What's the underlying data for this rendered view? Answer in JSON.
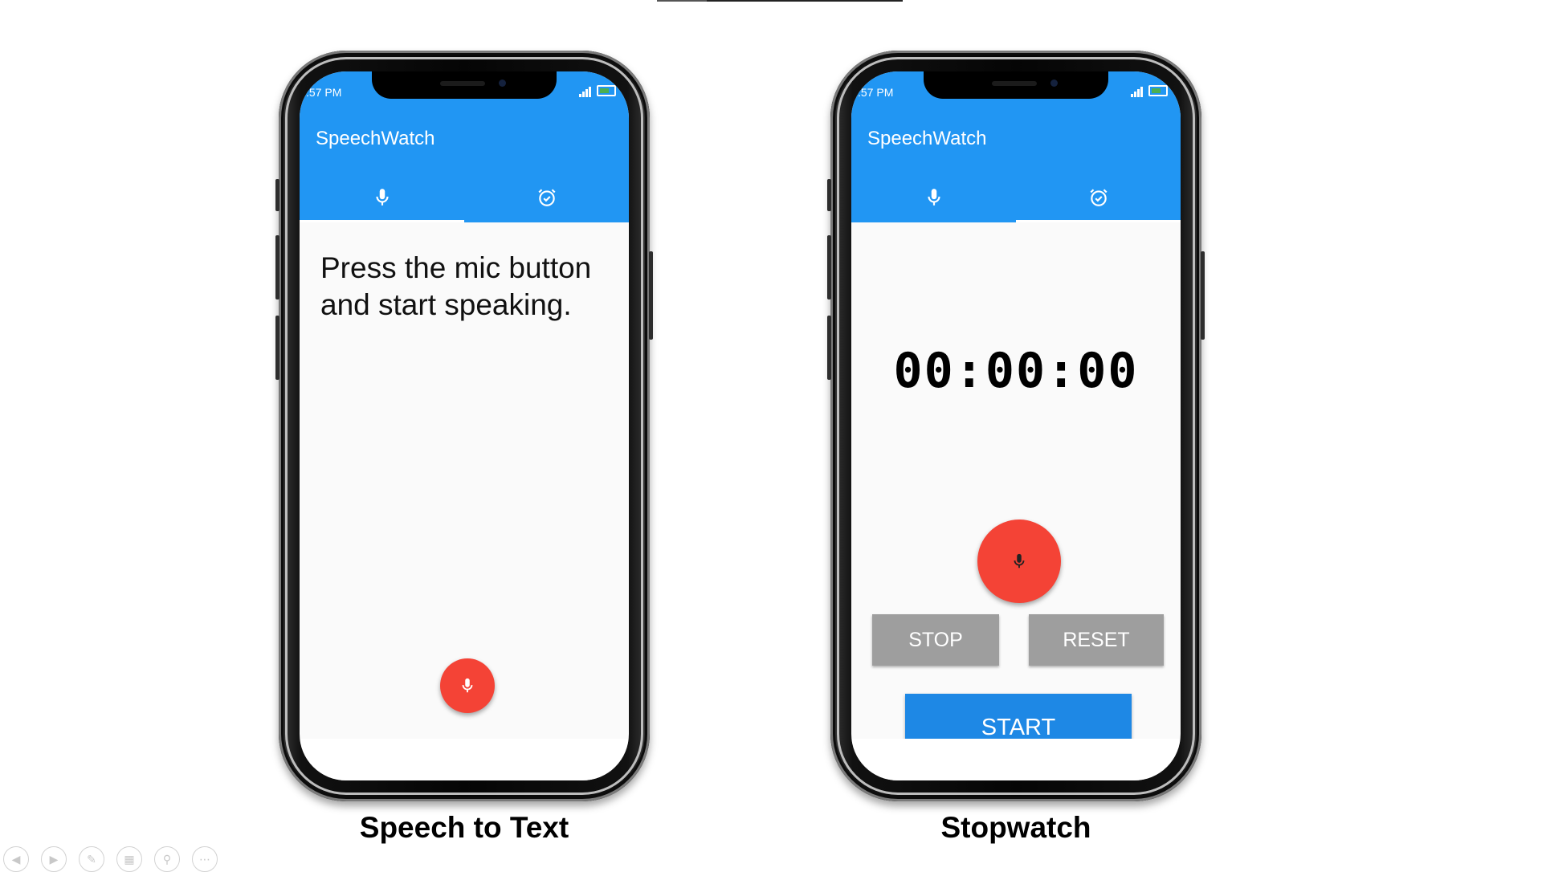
{
  "phones": [
    {
      "status_time": ":57 PM",
      "app_title": "SpeechWatch",
      "tabs": [
        {
          "icon": "mic-icon",
          "active": true
        },
        {
          "icon": "alarm-check-icon",
          "active": false
        }
      ],
      "prompt_text": "Press the mic button and start speaking.",
      "caption": "Speech to Text"
    },
    {
      "status_time": ":57 PM",
      "app_title": "SpeechWatch",
      "tabs": [
        {
          "icon": "mic-icon",
          "active": false
        },
        {
          "icon": "alarm-check-icon",
          "active": true
        }
      ],
      "clock_display": "00:00:00",
      "buttons": {
        "stop": "STOP",
        "reset": "RESET",
        "start": "START"
      },
      "caption": "Stopwatch"
    }
  ],
  "colors": {
    "app_bar": "#2196f3",
    "fab": "#f44336",
    "start_button": "#1e88e5",
    "secondary_button": "#9e9e9e"
  },
  "slide_controls": [
    "prev-icon",
    "next-icon",
    "pen-icon",
    "slides-icon",
    "zoom-icon",
    "more-icon"
  ]
}
